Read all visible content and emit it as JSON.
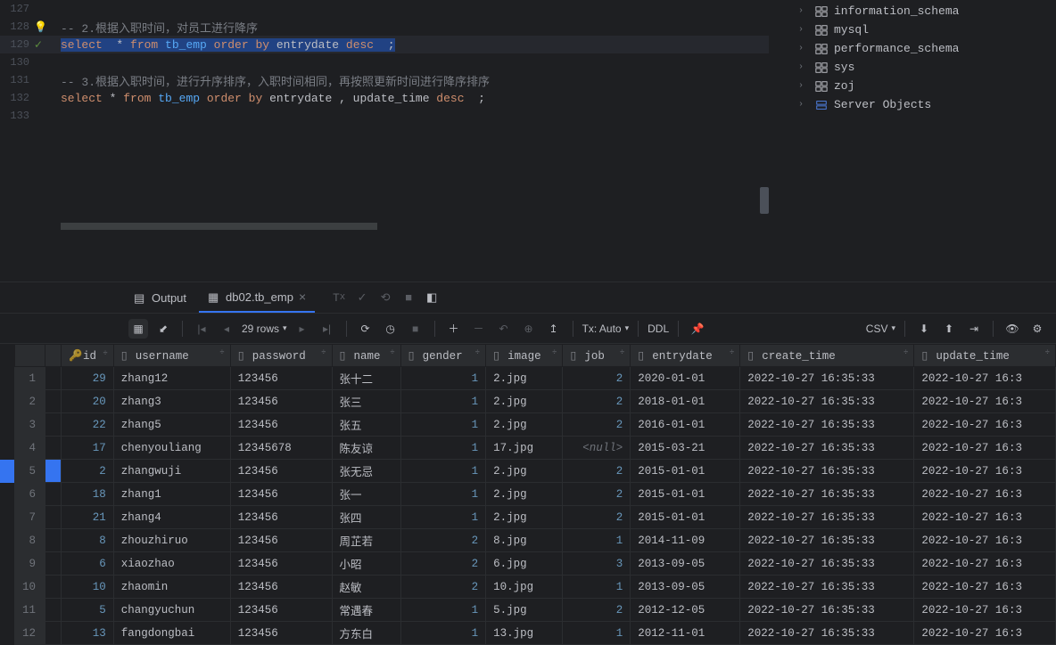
{
  "editor": {
    "lines": [
      {
        "no": "127",
        "marker": "",
        "content": []
      },
      {
        "no": "128",
        "marker": "bulb",
        "content": [
          {
            "c": "cmt",
            "t": "-- 2.根据入职时间，对员工进行降序"
          }
        ]
      },
      {
        "no": "129",
        "marker": "chk",
        "hl": true,
        "content": [
          {
            "c": "kw",
            "t": "select  "
          },
          {
            "c": "",
            "t": "* "
          },
          {
            "c": "kw",
            "t": "from "
          },
          {
            "c": "tbl",
            "t": "tb_emp "
          },
          {
            "c": "kw",
            "t": "order by "
          },
          {
            "c": "",
            "t": "entrydate "
          },
          {
            "c": "kw",
            "t": "desc "
          },
          {
            "c": "",
            "t": " ;"
          }
        ]
      },
      {
        "no": "130",
        "marker": "",
        "content": []
      },
      {
        "no": "131",
        "marker": "",
        "content": [
          {
            "c": "cmt",
            "t": "-- 3.根据入职时间，进行升序排序，入职时间相同，再按照更新时间进行降序排序"
          }
        ]
      },
      {
        "no": "132",
        "marker": "",
        "content": [
          {
            "c": "kw",
            "t": "select "
          },
          {
            "c": "",
            "t": "* "
          },
          {
            "c": "kw",
            "t": "from "
          },
          {
            "c": "tbl",
            "t": "tb_emp "
          },
          {
            "c": "kw",
            "t": "order by "
          },
          {
            "c": "",
            "t": "entrydate , update_time "
          },
          {
            "c": "kw",
            "t": "desc "
          },
          {
            "c": "",
            "t": " ;"
          }
        ]
      },
      {
        "no": "133",
        "marker": "",
        "content": []
      }
    ]
  },
  "tree": [
    {
      "icon": "schema",
      "label": "information_schema"
    },
    {
      "icon": "schema",
      "label": "mysql"
    },
    {
      "icon": "schema",
      "label": "performance_schema"
    },
    {
      "icon": "schema",
      "label": "sys"
    },
    {
      "icon": "schema",
      "label": "zoj"
    },
    {
      "icon": "server",
      "label": "Server Objects"
    }
  ],
  "tabs": {
    "output": "Output",
    "active": "db02.tb_emp"
  },
  "toolbar": {
    "rows": "29 rows",
    "tx": "Tx: Auto",
    "ddl": "DDL",
    "csv": "CSV"
  },
  "columns": [
    "id",
    "username",
    "password",
    "name",
    "gender",
    "image",
    "job",
    "entrydate",
    "create_time",
    "update_time"
  ],
  "data": [
    {
      "n": 1,
      "id": 29,
      "user": "zhang12",
      "pw": "123456",
      "name": "张十二",
      "g": 1,
      "img": "2.jpg",
      "job": "2",
      "ed": "2020-01-01",
      "ct": "2022-10-27 16:35:33",
      "ut": "2022-10-27 16:3"
    },
    {
      "n": 2,
      "id": 20,
      "user": "zhang3",
      "pw": "123456",
      "name": "张三",
      "g": 1,
      "img": "2.jpg",
      "job": "2",
      "ed": "2018-01-01",
      "ct": "2022-10-27 16:35:33",
      "ut": "2022-10-27 16:3"
    },
    {
      "n": 3,
      "id": 22,
      "user": "zhang5",
      "pw": "123456",
      "name": "张五",
      "g": 1,
      "img": "2.jpg",
      "job": "2",
      "ed": "2016-01-01",
      "ct": "2022-10-27 16:35:33",
      "ut": "2022-10-27 16:3"
    },
    {
      "n": 4,
      "id": 17,
      "user": "chenyouliang",
      "pw": "12345678",
      "name": "陈友谅",
      "g": 1,
      "img": "17.jpg",
      "job": "<null>",
      "ed": "2015-03-21",
      "ct": "2022-10-27 16:35:33",
      "ut": "2022-10-27 16:3"
    },
    {
      "n": 5,
      "id": 2,
      "user": "zhangwuji",
      "pw": "123456",
      "name": "张无忌",
      "g": 1,
      "img": "2.jpg",
      "job": "2",
      "ed": "2015-01-01",
      "ct": "2022-10-27 16:35:33",
      "ut": "2022-10-27 16:3"
    },
    {
      "n": 6,
      "id": 18,
      "user": "zhang1",
      "pw": "123456",
      "name": "张一",
      "g": 1,
      "img": "2.jpg",
      "job": "2",
      "ed": "2015-01-01",
      "ct": "2022-10-27 16:35:33",
      "ut": "2022-10-27 16:3"
    },
    {
      "n": 7,
      "id": 21,
      "user": "zhang4",
      "pw": "123456",
      "name": "张四",
      "g": 1,
      "img": "2.jpg",
      "job": "2",
      "ed": "2015-01-01",
      "ct": "2022-10-27 16:35:33",
      "ut": "2022-10-27 16:3"
    },
    {
      "n": 8,
      "id": 8,
      "user": "zhouzhiruo",
      "pw": "123456",
      "name": "周芷若",
      "g": 2,
      "img": "8.jpg",
      "job": "1",
      "ed": "2014-11-09",
      "ct": "2022-10-27 16:35:33",
      "ut": "2022-10-27 16:3"
    },
    {
      "n": 9,
      "id": 6,
      "user": "xiaozhao",
      "pw": "123456",
      "name": "小昭",
      "g": 2,
      "img": "6.jpg",
      "job": "3",
      "ed": "2013-09-05",
      "ct": "2022-10-27 16:35:33",
      "ut": "2022-10-27 16:3"
    },
    {
      "n": 10,
      "id": 10,
      "user": "zhaomin",
      "pw": "123456",
      "name": "赵敏",
      "g": 2,
      "img": "10.jpg",
      "job": "1",
      "ed": "2013-09-05",
      "ct": "2022-10-27 16:35:33",
      "ut": "2022-10-27 16:3"
    },
    {
      "n": 11,
      "id": 5,
      "user": "changyuchun",
      "pw": "123456",
      "name": "常遇春",
      "g": 1,
      "img": "5.jpg",
      "job": "2",
      "ed": "2012-12-05",
      "ct": "2022-10-27 16:35:33",
      "ut": "2022-10-27 16:3"
    },
    {
      "n": 12,
      "id": 13,
      "user": "fangdongbai",
      "pw": "123456",
      "name": "方东白",
      "g": 1,
      "img": "13.jpg",
      "job": "1",
      "ed": "2012-11-01",
      "ct": "2022-10-27 16:35:33",
      "ut": "2022-10-27 16:3"
    }
  ]
}
